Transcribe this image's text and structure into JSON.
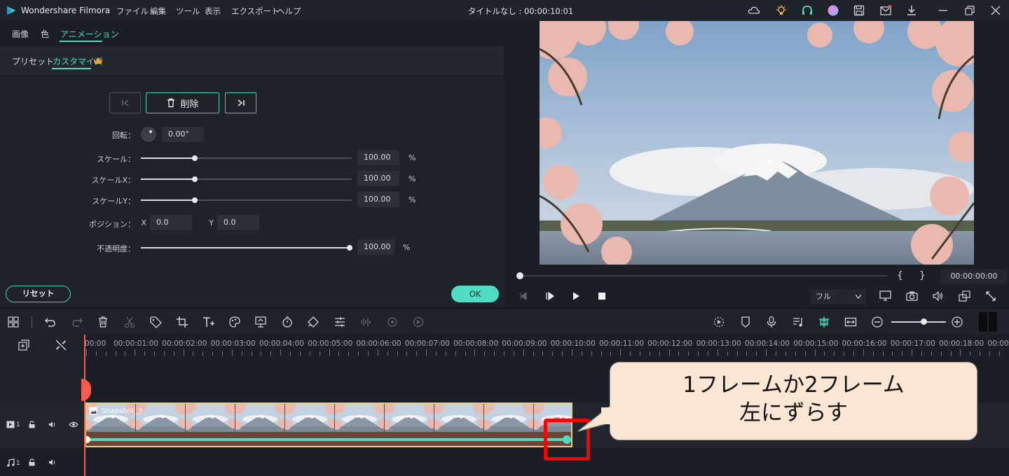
{
  "titlebar": {
    "app_name": "Wondershare Filmora",
    "menus": [
      "ファイル",
      "編集",
      "ツール",
      "表示",
      "エクスポート",
      "ヘルプ"
    ],
    "window_title": "タイトルなし : 00:00:10:01"
  },
  "left_panel": {
    "tabs": [
      "画像",
      "色",
      "アニメーション"
    ],
    "subtabs": [
      "プリセット",
      "カスタマイズ"
    ],
    "delete_label": "削除",
    "rotation": {
      "label": "回転：",
      "value": "0.00°"
    },
    "scale": {
      "label": "スケール：",
      "value": "100.00",
      "unit": "%",
      "level": 0.25
    },
    "scale_x": {
      "label": "スケールX：",
      "value": "100.00",
      "unit": "%",
      "level": 0.25
    },
    "scale_y": {
      "label": "スケールY：",
      "value": "100.00",
      "unit": "%",
      "level": 0.25
    },
    "position": {
      "label": "ポジション：",
      "x_label": "X",
      "x_value": "0.0",
      "y_label": "Y",
      "y_value": "0.0"
    },
    "opacity": {
      "label": "不透明度：",
      "value": "100.00",
      "unit": "%",
      "level": 1.0
    },
    "reset_label": "リセット",
    "ok_label": "OK"
  },
  "preview": {
    "timecode": "00:00:00:00",
    "bracket_in": "{",
    "bracket_out": "}",
    "quality": "フル"
  },
  "timeline": {
    "ruler_labels": [
      "00:00",
      "00:00:01:00",
      "00:00:02:00",
      "00:00:03:00",
      "00:00:04:00",
      "00:00:05:00",
      "00:00:06:00",
      "00:00:07:00",
      "00:00:08:00",
      "00:00:09:00",
      "00:00:10:00",
      "00:00:11:00",
      "00:00:12:00",
      "00:00:13:00",
      "00:00:14:00",
      "00:00:15:00",
      "00:00:16:00",
      "00:00:17:00",
      "00:00:18:00",
      "00:00"
    ],
    "clip_name": "Snapshot_3",
    "video_track": "1",
    "audio_track": "1"
  },
  "callout": {
    "line1": "1フレームか2フレーム",
    "line2": "左にずらす"
  },
  "colors": {
    "accent": "#4fdcc3",
    "highlight": "#ff0000",
    "playhead": "#ff5a4e"
  }
}
